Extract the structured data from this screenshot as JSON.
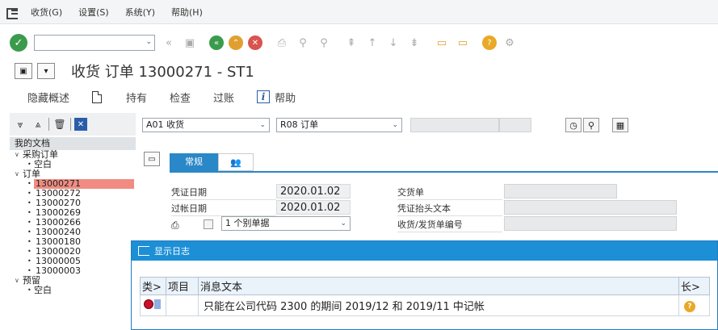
{
  "menu": {
    "items": [
      "收货(G)",
      "设置(S)",
      "系统(Y)",
      "帮助(H)"
    ]
  },
  "toolbar": {
    "command_field_value": "",
    "icons": [
      "ok-icon",
      "back-icon",
      "save-icon",
      "back-green-icon",
      "exit-icon",
      "cancel-icon",
      "print-icon",
      "find-icon",
      "find-next-icon",
      "first-page-icon",
      "prev-page-icon",
      "next-page-icon",
      "last-page-icon",
      "new-session-icon",
      "shortcut-icon",
      "help-icon",
      "settings-icon"
    ]
  },
  "title": {
    "text": "收货 订单 13000271 - ST1"
  },
  "app_toolbar": {
    "hide_overview": "隐藏概述",
    "hold": "持有",
    "check": "检查",
    "post": "过账",
    "help": "帮助"
  },
  "left_panel": {
    "header": "我的文档",
    "tree": [
      {
        "label": "采购订单",
        "level": 1,
        "expanded": true
      },
      {
        "label": "空白",
        "level": 2
      },
      {
        "label": "订单",
        "level": 1,
        "expanded": true
      },
      {
        "label": "13000271",
        "level": 2,
        "selected": true
      },
      {
        "label": "13000272",
        "level": 2
      },
      {
        "label": "13000270",
        "level": 2
      },
      {
        "label": "13000269",
        "level": 2
      },
      {
        "label": "13000266",
        "level": 2
      },
      {
        "label": "13000240",
        "level": 2
      },
      {
        "label": "13000180",
        "level": 2
      },
      {
        "label": "13000020",
        "level": 2
      },
      {
        "label": "13000005",
        "level": 2
      },
      {
        "label": "13000003",
        "level": 2
      },
      {
        "label": "预留",
        "level": 1,
        "expanded": true
      },
      {
        "label": "空白",
        "level": 2
      }
    ]
  },
  "main": {
    "transaction_select": "A01 收货",
    "reference_select": "R08 订单",
    "tabs": {
      "general": "常规"
    },
    "fields": {
      "doc_date_label": "凭证日期",
      "doc_date_value": "2020.01.02",
      "post_date_label": "过帐日期",
      "post_date_value": "2020.01.02",
      "slip_select": "1 个别单据",
      "delivery_note_label": "交货单",
      "header_text_label": "凭证抬头文本",
      "bill_label": "收货/发货单编号"
    }
  },
  "dialog": {
    "title": "显示日志",
    "columns": {
      "type": "类>",
      "item": "项目",
      "message": "消息文本",
      "long": "长>"
    },
    "rows": [
      {
        "item": "",
        "message": "只能在公司代码 2300 的期间 2019/12 和 2019/11 中记帐"
      }
    ]
  },
  "colors": {
    "accent": "#1d8fd6",
    "selected_row": "#f08c82",
    "error": "#c8102e"
  }
}
